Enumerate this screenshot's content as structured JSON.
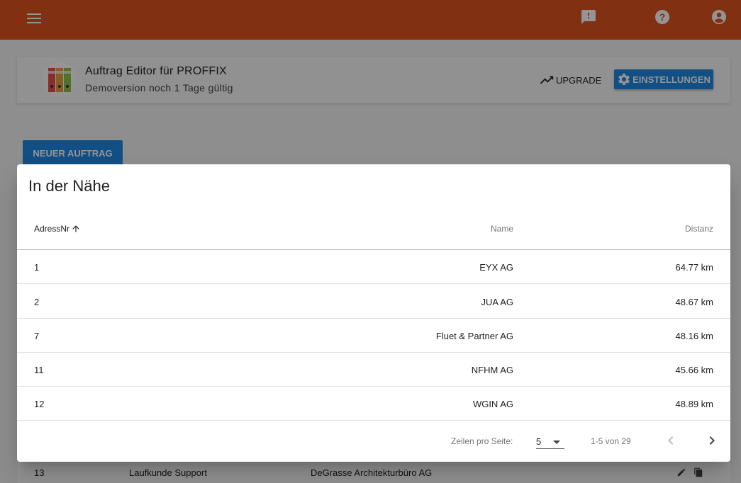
{
  "appbar": {
    "menu_icon": "hamburger-menu-icon",
    "feedback_icon": "feedback-icon",
    "help_icon": "help-icon",
    "account_icon": "account-circle-icon",
    "color": "#e0541f"
  },
  "header": {
    "title": "Auftrag Editor für PROFFIX",
    "subtitle": "Demoversion noch 1 Tage gültig",
    "upgrade_label": "UPGRADE",
    "settings_label": "EINSTELLUNGEN"
  },
  "main": {
    "new_order_label": "NEUER AUFTRAG",
    "background_row": {
      "nr": "13",
      "name": "Laufkunde Support",
      "company": "DeGrasse Architekturbüro  AG"
    }
  },
  "dialog": {
    "title": "In der Nähe",
    "columns": {
      "adressnr": "AdressNr",
      "name": "Name",
      "distanz": "Distanz"
    },
    "rows": [
      {
        "nr": "1",
        "name": "EYX AG",
        "distance": "64.77 km"
      },
      {
        "nr": "2",
        "name": "JUA AG",
        "distance": "48.67 km"
      },
      {
        "nr": "7",
        "name": "Fluet & Partner AG",
        "distance": "48.16 km"
      },
      {
        "nr": "11",
        "name": "NFHM AG",
        "distance": "45.66 km"
      },
      {
        "nr": "12",
        "name": "WGIN AG",
        "distance": "48.89 km"
      }
    ],
    "pagination": {
      "rows_per_page_label": "Zeilen pro Seite:",
      "rows_per_page_value": "5",
      "range_text": "1-5 von 29"
    }
  }
}
